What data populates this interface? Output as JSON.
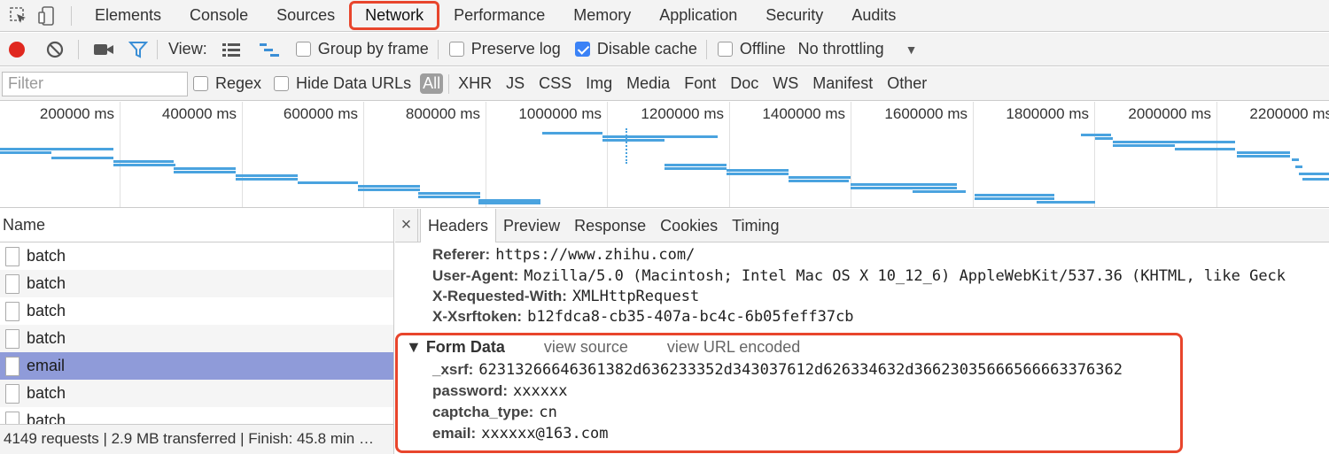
{
  "tabs": [
    {
      "label": "Elements"
    },
    {
      "label": "Console"
    },
    {
      "label": "Sources"
    },
    {
      "label": "Network"
    },
    {
      "label": "Performance"
    },
    {
      "label": "Memory"
    },
    {
      "label": "Application"
    },
    {
      "label": "Security"
    },
    {
      "label": "Audits"
    }
  ],
  "toolbar": {
    "view_label": "View:",
    "group_by_frame": "Group by frame",
    "preserve_log": "Preserve log",
    "disable_cache": "Disable cache",
    "disable_cache_checked": true,
    "offline": "Offline",
    "throttling": "No throttling",
    "record_color": "#e0281f",
    "filter_icon_color": "#3b8fd6"
  },
  "filter": {
    "placeholder": "Filter",
    "regex": "Regex",
    "hide_data_urls": "Hide Data URLs",
    "types": [
      "All",
      "XHR",
      "JS",
      "CSS",
      "Img",
      "Media",
      "Font",
      "Doc",
      "WS",
      "Manifest",
      "Other"
    ]
  },
  "overview": {
    "ticks": [
      "200000 ms",
      "400000 ms",
      "600000 ms",
      "800000 ms",
      "1000000 ms",
      "1200000 ms",
      "1400000 ms",
      "1600000 ms",
      "1800000 ms",
      "2000000 ms",
      "2200000 ms"
    ],
    "bar_color": "#4aa3df"
  },
  "requests": {
    "header": "Name",
    "rows": [
      {
        "name": "batch",
        "selected": false
      },
      {
        "name": "batch",
        "selected": false
      },
      {
        "name": "batch",
        "selected": false
      },
      {
        "name": "batch",
        "selected": false
      },
      {
        "name": "email",
        "selected": true
      },
      {
        "name": "batch",
        "selected": false
      },
      {
        "name": "batch",
        "selected": false
      }
    ]
  },
  "status": "4149 requests | 2.9 MB transferred | Finish: 45.8 min …",
  "details": {
    "close": "×",
    "tabs": [
      "Headers",
      "Preview",
      "Response",
      "Cookies",
      "Timing"
    ],
    "active_tab": "Headers",
    "headers": [
      {
        "key": "Referer:",
        "value": "https://www.zhihu.com/"
      },
      {
        "key": "User-Agent:",
        "value": "Mozilla/5.0 (Macintosh; Intel Mac OS X 10_12_6) AppleWebKit/537.36 (KHTML, like Geck"
      },
      {
        "key": "X-Requested-With:",
        "value": "XMLHttpRequest"
      },
      {
        "key": "X-Xsrftoken:",
        "value": "b12fdca8-cb35-407a-bc4c-6b05feff37cb"
      }
    ],
    "form_data": {
      "title": "▼ Form Data",
      "view_source": "view source",
      "view_url_encoded": "view URL encoded",
      "fields": [
        {
          "key": "_xsrf:",
          "value": "62313266646361382d636233352d343037612d626334632d36623035666566663376362"
        },
        {
          "key": "password:",
          "value": "xxxxxx"
        },
        {
          "key": "captcha_type:",
          "value": "cn"
        },
        {
          "key": "email:",
          "value": "xxxxxx@163.com"
        }
      ]
    }
  },
  "highlight_color": "#e8452c"
}
